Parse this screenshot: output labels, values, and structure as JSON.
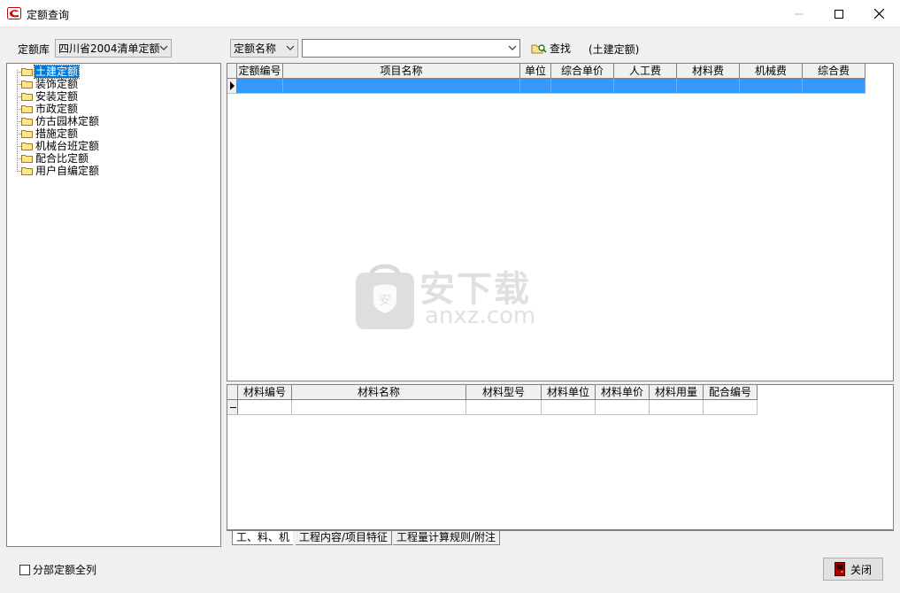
{
  "window": {
    "title": "定额查询"
  },
  "toolbar": {
    "library_label": "定额库",
    "library_value": "四川省2004清单定额",
    "search_field_value": "定额名称",
    "search_input_value": "",
    "find_label": "查找",
    "category_note": "(土建定额)"
  },
  "tree": {
    "items": [
      {
        "label": "土建定额",
        "selected": true
      },
      {
        "label": "装饰定额"
      },
      {
        "label": "安装定额"
      },
      {
        "label": "市政定额"
      },
      {
        "label": "仿古园林定额"
      },
      {
        "label": "措施定额"
      },
      {
        "label": "机械台班定额"
      },
      {
        "label": "配合比定额"
      },
      {
        "label": "用户自编定额"
      }
    ]
  },
  "quota_grid": {
    "columns": [
      "定额编号",
      "项目名称",
      "单位",
      "综合单价",
      "人工费",
      "材料费",
      "机械费",
      "综合费"
    ]
  },
  "material_grid": {
    "columns": [
      "材料编号",
      "材料名称",
      "材料型号",
      "材料单位",
      "材料单价",
      "材料用量",
      "配合编号"
    ]
  },
  "tabs": [
    "工、料、机",
    "工程内容/项目特征",
    "工程量计算规则/附注"
  ],
  "footer": {
    "show_all_label": "分部定额全列",
    "show_all_checked": false,
    "close_label": "关闭"
  },
  "watermark": {
    "text": "安下载",
    "subtext": "anxz.com"
  },
  "colors": {
    "selection": "#3399ff",
    "tree_selection": "#0078d7"
  }
}
